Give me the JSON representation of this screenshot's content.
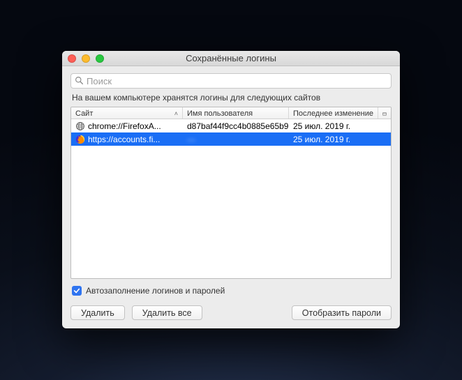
{
  "window": {
    "title": "Сохранённые логины"
  },
  "search": {
    "placeholder": "Поиск"
  },
  "description": "На вашем компьютере хранятся логины для следующих сайтов",
  "columns": {
    "site": "Сайт",
    "user": "Имя пользователя",
    "modified": "Последнее изменение"
  },
  "rows": [
    {
      "icon": "globe",
      "site": "chrome://FirefoxA...",
      "user": "d87baf44f9cc4b0885e65b9...",
      "modified": "25 июл. 2019 г.",
      "selected": false
    },
    {
      "icon": "firefox",
      "site": "https://accounts.fi...",
      "user": "—",
      "user_blurred": true,
      "modified": "25 июл. 2019 г.",
      "selected": true
    }
  ],
  "checkbox": {
    "checked": true,
    "label": "Автозаполнение логинов и паролей"
  },
  "buttons": {
    "delete": "Удалить",
    "delete_all": "Удалить все",
    "show_passwords": "Отобразить пароли"
  }
}
